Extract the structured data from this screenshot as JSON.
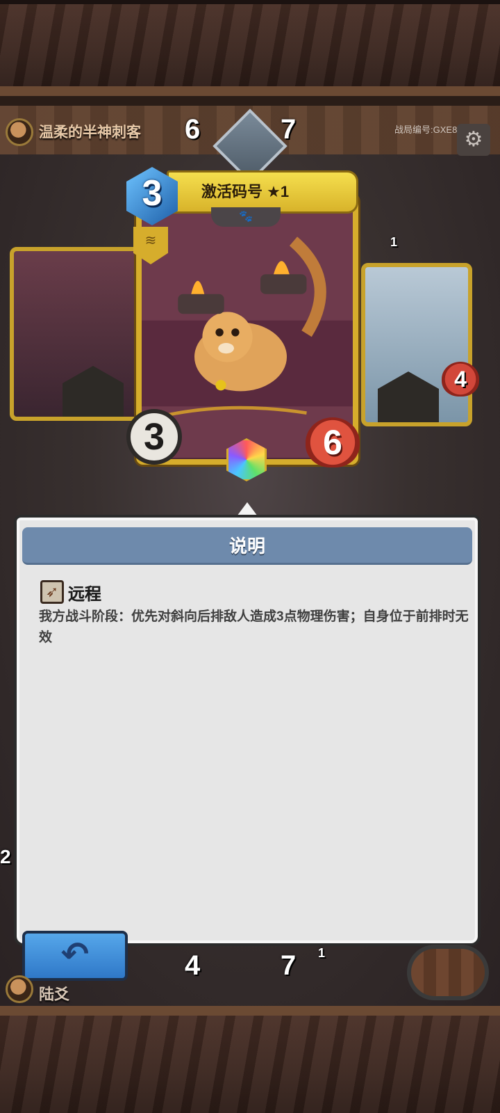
{
  "top_player": {
    "name": "温柔的半神刺客",
    "stat_left": "6",
    "stat_right": "7"
  },
  "battle_id": "战局编号:GXE8",
  "settings_icon": "gear-icon",
  "card": {
    "cost": "3",
    "title": "激活码号 ★1",
    "tribe_icon": "paw-icon",
    "attack": "3",
    "health": "6",
    "rarity_gem": "rainbow-gem-icon"
  },
  "right_card": {
    "shield_count": "1",
    "health": "4"
  },
  "panel": {
    "title": "说明",
    "ability_icon": "bow-icon",
    "ability_name": "远程",
    "ability_desc": "我方战斗阶段：优先对斜向后排敌人造成3点物理伤害；自身位于前排时无效"
  },
  "bottom_player": {
    "name": "陆爻",
    "stat_left": "4",
    "stat_right": "7",
    "small_count": "1",
    "side_count": "2"
  },
  "back_button_icon": "back-arrow-icon",
  "colors": {
    "card_gold": "#d6ad2c",
    "panel_header": "#6e8aac",
    "back_button": "#3b8ad8",
    "heart_red": "#e0533f",
    "cost_blue": "#2f7fd0"
  }
}
